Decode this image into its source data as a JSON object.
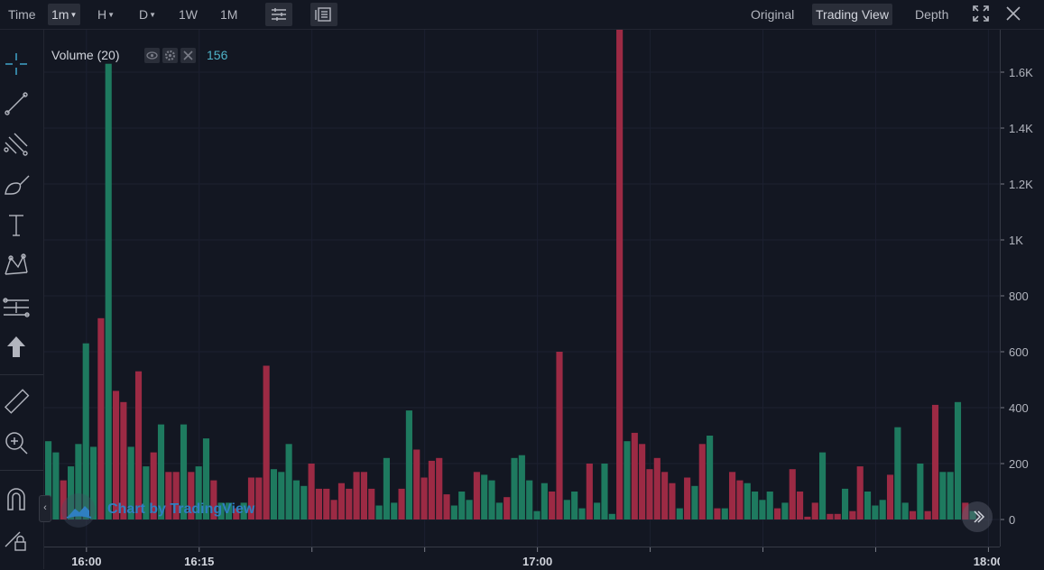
{
  "toolbar": {
    "time_label": "Time",
    "intervals": [
      "1m",
      "H",
      "D",
      "1W",
      "1M"
    ],
    "active_interval": "1m",
    "views": [
      "Original",
      "Trading View",
      "Depth"
    ],
    "active_view": "Trading View"
  },
  "tools": [
    "crosshair-icon",
    "trend-line-icon",
    "pitchfork-icon",
    "brush-icon",
    "text-icon",
    "pattern-icon",
    "fib-icon",
    "arrow-up-icon",
    "ruler-icon",
    "zoom-icon",
    "magnet-icon",
    "lock-icon"
  ],
  "legend": {
    "title": "Volume (20)",
    "value": "156"
  },
  "watermark": "Chart by TradingView",
  "colors": {
    "up": "#26a69a",
    "down": "#ef5350",
    "background": "#131722",
    "accent": "#4fb3c8"
  },
  "chart_data": {
    "type": "bar",
    "title": "Volume (20)",
    "ylim": [
      0,
      1700
    ],
    "y_ticks": [
      0,
      200,
      400,
      600,
      800,
      1000,
      1200,
      1400,
      1600
    ],
    "y_tick_labels": [
      "0",
      "200",
      "400",
      "600",
      "800",
      "1K",
      "1.2K",
      "1.4K",
      "1.6K"
    ],
    "x_tick_labels": [
      "16:00",
      "16:15",
      "17:00",
      "18:00"
    ],
    "x_tick_bars": [
      5,
      20,
      65,
      125
    ],
    "series": [
      {
        "values": [
          280,
          240,
          140,
          190,
          270,
          630,
          260,
          720,
          1630,
          460,
          420,
          260,
          530,
          190,
          240,
          340,
          170,
          170,
          340,
          170,
          190,
          290,
          140,
          60,
          60,
          40,
          60,
          150,
          150,
          550,
          180,
          170,
          270,
          140,
          120,
          200,
          110,
          110,
          70,
          130,
          110,
          170,
          170,
          110,
          50,
          220,
          60,
          110,
          390,
          250,
          150,
          210,
          220,
          90,
          50,
          100,
          70,
          170,
          160,
          140,
          60,
          80,
          220,
          230,
          140,
          30,
          130,
          100,
          600,
          70,
          100,
          40,
          200,
          60,
          200,
          20,
          1900,
          280,
          310,
          270,
          180,
          220,
          170,
          130,
          40,
          150,
          120,
          270,
          300,
          40,
          40,
          170,
          140,
          130,
          100,
          70,
          100,
          40,
          60,
          180,
          100,
          10,
          60,
          240,
          20,
          20,
          110,
          30,
          190,
          100,
          50,
          70,
          160,
          330,
          60,
          30,
          200,
          30,
          410,
          170,
          170,
          420,
          60,
          30,
          0,
          0,
          0,
          0,
          0,
          0,
          0,
          0,
          0,
          0
        ],
        "directions": [
          1,
          1,
          0,
          1,
          1,
          1,
          1,
          0,
          1,
          0,
          0,
          1,
          0,
          1,
          0,
          1,
          0,
          0,
          1,
          0,
          1,
          1,
          0,
          1,
          1,
          0,
          1,
          0,
          0,
          0,
          1,
          1,
          1,
          1,
          1,
          0,
          0,
          0,
          0,
          0,
          0,
          0,
          0,
          0,
          1,
          1,
          1,
          0,
          1,
          0,
          0,
          0,
          0,
          0,
          1,
          1,
          1,
          0,
          1,
          1,
          1,
          0,
          1,
          1,
          1,
          1,
          1,
          0,
          0,
          1,
          1,
          1,
          0,
          1,
          1,
          1,
          0,
          1,
          0,
          0,
          0,
          0,
          0,
          0,
          1,
          0,
          1,
          0,
          1,
          0,
          1,
          0,
          0,
          1,
          1,
          1,
          1,
          0,
          1,
          0,
          0,
          0,
          0,
          1,
          0,
          0,
          1,
          0,
          0,
          1,
          1,
          1,
          0,
          1,
          1,
          0,
          1,
          0,
          0,
          1,
          1,
          1,
          0,
          1,
          0,
          0,
          0,
          0,
          0,
          0,
          0,
          0,
          0,
          0
        ]
      }
    ]
  }
}
